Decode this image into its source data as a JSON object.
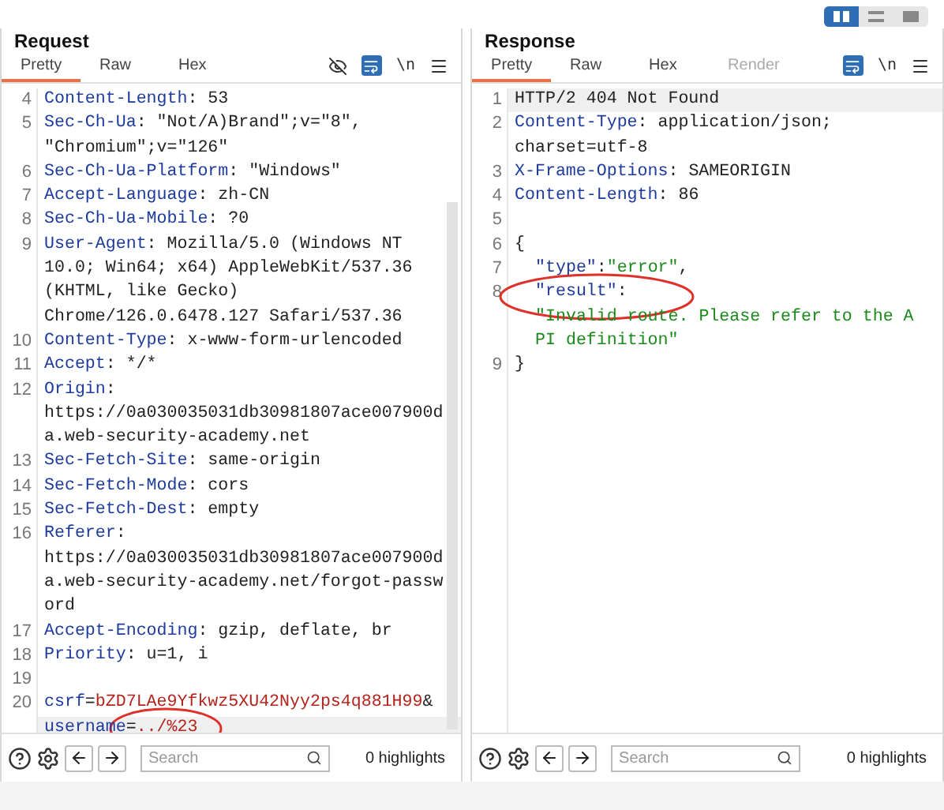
{
  "view_toggles": [
    {
      "kind": "columns",
      "selected": true
    },
    {
      "kind": "rows",
      "selected": false
    },
    {
      "kind": "single",
      "selected": false
    }
  ],
  "panes": [
    {
      "title": "Request",
      "tabs": [
        {
          "label": "Pretty",
          "selected": true,
          "disabled": false
        },
        {
          "label": "Raw",
          "selected": false,
          "disabled": false
        },
        {
          "label": "Hex",
          "selected": false,
          "disabled": false
        }
      ],
      "tools": [
        {
          "kind": "hide"
        },
        {
          "kind": "wrap",
          "selected": true
        },
        {
          "kind": "newline",
          "text": "\\n"
        },
        {
          "kind": "menu"
        }
      ],
      "scrollbar": true,
      "lines": [
        {
          "number": "4",
          "parts": [
            {
              "kind": "key",
              "text": "Content-Length"
            },
            {
              "kind": "plain",
              "text": ": 53"
            }
          ]
        },
        {
          "number": "5",
          "parts": [
            {
              "kind": "key",
              "text": "Sec-Ch-Ua"
            },
            {
              "kind": "plain",
              "text": ": \"Not/A)Brand\";v=\"8\","
            }
          ]
        },
        {
          "parts": [
            {
              "kind": "plain",
              "text": "\"Chromium\";v=\"126\""
            }
          ]
        },
        {
          "number": "6",
          "parts": [
            {
              "kind": "key",
              "text": "Sec-Ch-Ua-Platform"
            },
            {
              "kind": "plain",
              "text": ": \"Windows\""
            }
          ]
        },
        {
          "number": "7",
          "parts": [
            {
              "kind": "key",
              "text": "Accept-Language"
            },
            {
              "kind": "plain",
              "text": ": zh-CN"
            }
          ]
        },
        {
          "number": "8",
          "parts": [
            {
              "kind": "key",
              "text": "Sec-Ch-Ua-Mobile"
            },
            {
              "kind": "plain",
              "text": ": ?0"
            }
          ]
        },
        {
          "number": "9",
          "parts": [
            {
              "kind": "key",
              "text": "User-Agent"
            },
            {
              "kind": "plain",
              "text": ": Mozilla/5.0 (Windows NT"
            }
          ]
        },
        {
          "parts": [
            {
              "kind": "plain",
              "text": "10.0; Win64; x64) AppleWebKit/537.36"
            }
          ]
        },
        {
          "parts": [
            {
              "kind": "plain",
              "text": "(KHTML, like Gecko)"
            }
          ]
        },
        {
          "parts": [
            {
              "kind": "plain",
              "text": "Chrome/126.0.6478.127 Safari/537.36"
            }
          ]
        },
        {
          "number": "10",
          "parts": [
            {
              "kind": "key",
              "text": "Content-Type"
            },
            {
              "kind": "plain",
              "text": ": x-www-form-urlencoded"
            }
          ]
        },
        {
          "number": "11",
          "parts": [
            {
              "kind": "key",
              "text": "Accept"
            },
            {
              "kind": "plain",
              "text": ": */*"
            }
          ]
        },
        {
          "number": "12",
          "parts": [
            {
              "kind": "key",
              "text": "Origin"
            },
            {
              "kind": "plain",
              "text": ":"
            }
          ]
        },
        {
          "parts": [
            {
              "kind": "plain",
              "text": "https://0a030035031db30981807ace007900d"
            }
          ]
        },
        {
          "parts": [
            {
              "kind": "plain",
              "text": "a.web-security-academy.net"
            }
          ]
        },
        {
          "number": "13",
          "parts": [
            {
              "kind": "key",
              "text": "Sec-Fetch-Site"
            },
            {
              "kind": "plain",
              "text": ": same-origin"
            }
          ]
        },
        {
          "number": "14",
          "parts": [
            {
              "kind": "key",
              "text": "Sec-Fetch-Mode"
            },
            {
              "kind": "plain",
              "text": ": cors"
            }
          ]
        },
        {
          "number": "15",
          "parts": [
            {
              "kind": "key",
              "text": "Sec-Fetch-Dest"
            },
            {
              "kind": "plain",
              "text": ": empty"
            }
          ]
        },
        {
          "number": "16",
          "parts": [
            {
              "kind": "key",
              "text": "Referer"
            },
            {
              "kind": "plain",
              "text": ":"
            }
          ]
        },
        {
          "parts": [
            {
              "kind": "plain",
              "text": "https://0a030035031db30981807ace007900d"
            }
          ]
        },
        {
          "parts": [
            {
              "kind": "plain",
              "text": "a.web-security-academy.net/forgot-passw"
            }
          ]
        },
        {
          "parts": [
            {
              "kind": "plain",
              "text": "ord"
            }
          ]
        },
        {
          "number": "17",
          "parts": [
            {
              "kind": "key",
              "text": "Accept-Encoding"
            },
            {
              "kind": "plain",
              "text": ": gzip, deflate, br"
            }
          ]
        },
        {
          "number": "18",
          "parts": [
            {
              "kind": "key",
              "text": "Priority"
            },
            {
              "kind": "plain",
              "text": ": u=1, i"
            }
          ]
        },
        {
          "number": "19"
        },
        {
          "number": "20",
          "parts": [
            {
              "kind": "key",
              "text": "csrf"
            },
            {
              "kind": "plain",
              "text": "="
            },
            {
              "kind": "value",
              "text": "bZD7LAe9Yfkwz5XU42Nyy2ps4q881H99"
            },
            {
              "kind": "plain",
              "text": "&"
            }
          ]
        },
        {
          "highlighted": true,
          "annotation": {
            "kind": "ellipse"
          },
          "parts": [
            {
              "kind": "key",
              "text": "username"
            },
            {
              "kind": "plain",
              "text": "="
            },
            {
              "kind": "value",
              "text": "../%23"
            }
          ]
        }
      ],
      "search": {
        "placeholder": "Search"
      },
      "highlights": "0 highlights"
    },
    {
      "title": "Response",
      "tabs": [
        {
          "label": "Pretty",
          "selected": true,
          "disabled": false
        },
        {
          "label": "Raw",
          "selected": false,
          "disabled": false
        },
        {
          "label": "Hex",
          "selected": false,
          "disabled": false
        },
        {
          "label": "Render",
          "selected": false,
          "disabled": true
        }
      ],
      "tools": [
        {
          "kind": "wrap",
          "selected": true
        },
        {
          "kind": "newline",
          "text": "\\n"
        },
        {
          "kind": "menu"
        }
      ],
      "lines": [
        {
          "number": "1",
          "highlighted": true,
          "parts": [
            {
              "kind": "plain",
              "text": "HTTP/2 404 Not Found"
            }
          ]
        },
        {
          "number": "2",
          "parts": [
            {
              "kind": "key",
              "text": "Content-Type"
            },
            {
              "kind": "plain",
              "text": ": application/json;"
            }
          ]
        },
        {
          "parts": [
            {
              "kind": "plain",
              "text": "charset=utf-8"
            }
          ]
        },
        {
          "number": "3",
          "parts": [
            {
              "kind": "key",
              "text": "X-Frame-Options"
            },
            {
              "kind": "plain",
              "text": ": SAMEORIGIN"
            }
          ]
        },
        {
          "number": "4",
          "parts": [
            {
              "kind": "key",
              "text": "Content-Length"
            },
            {
              "kind": "plain",
              "text": ": 86"
            }
          ]
        },
        {
          "number": "5"
        },
        {
          "number": "6",
          "parts": [
            {
              "kind": "plain",
              "text": "{"
            }
          ]
        },
        {
          "number": "7",
          "indent": true,
          "parts": [
            {
              "kind": "key",
              "text": "\"type\""
            },
            {
              "kind": "plain",
              "text": ":"
            },
            {
              "kind": "string",
              "text": "\"error\""
            },
            {
              "kind": "plain",
              "text": ","
            }
          ]
        },
        {
          "number": "8",
          "indent": true,
          "annotation": {
            "kind": "ellipse"
          },
          "parts": [
            {
              "kind": "key",
              "text": "\"result\""
            },
            {
              "kind": "plain",
              "text": ":"
            }
          ]
        },
        {
          "indent": true,
          "parts": [
            {
              "kind": "string",
              "text": "\"Invalid route. Please refer to the A"
            }
          ]
        },
        {
          "indent": true,
          "parts": [
            {
              "kind": "string",
              "text": "PI definition\""
            }
          ]
        },
        {
          "number": "9",
          "parts": [
            {
              "kind": "plain",
              "text": "}"
            }
          ]
        }
      ],
      "search": {
        "placeholder": "Search"
      },
      "highlights": "0 highlights"
    }
  ]
}
